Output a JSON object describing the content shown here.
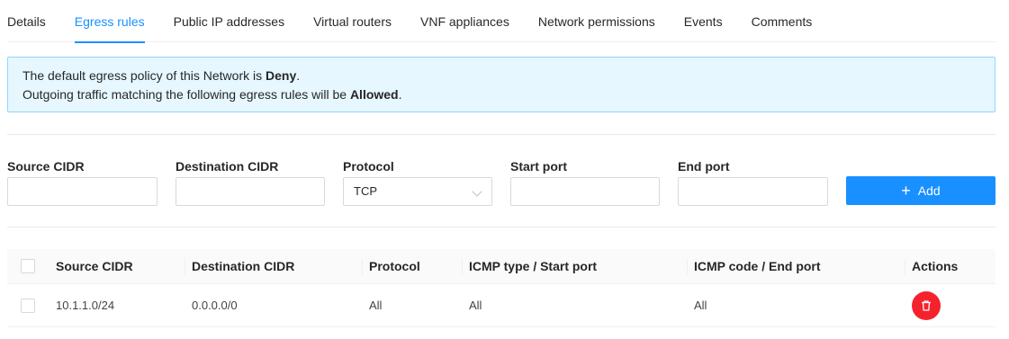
{
  "tabs": [
    "Details",
    "Egress rules",
    "Public IP addresses",
    "Virtual routers",
    "VNF appliances",
    "Network permissions",
    "Events",
    "Comments"
  ],
  "active_tab": "Egress rules",
  "alert": {
    "line1_prefix": "The default egress policy of this Network is ",
    "line1_bold": "Deny",
    "line1_suffix": ".",
    "line2_prefix": "Outgoing traffic matching the following egress rules will be ",
    "line2_bold": "Allowed",
    "line2_suffix": "."
  },
  "form": {
    "source_cidr_label": "Source CIDR",
    "source_cidr_value": "",
    "destination_cidr_label": "Destination CIDR",
    "destination_cidr_value": "",
    "protocol_label": "Protocol",
    "protocol_value": "TCP",
    "start_port_label": "Start port",
    "start_port_value": "",
    "end_port_label": "End port",
    "end_port_value": "",
    "add_label": "Add"
  },
  "table": {
    "headers": [
      "Source CIDR",
      "Destination CIDR",
      "Protocol",
      "ICMP type / Start port",
      "ICMP code / End port",
      "Actions"
    ],
    "rows": [
      [
        "10.1.1.0/24",
        "0.0.0.0/0",
        "All",
        "All",
        "All"
      ]
    ]
  },
  "colors": {
    "accent": "#1890ff",
    "alert_bg": "#e6f7ff",
    "alert_border": "#91d5ff",
    "danger": "#f5222d"
  }
}
